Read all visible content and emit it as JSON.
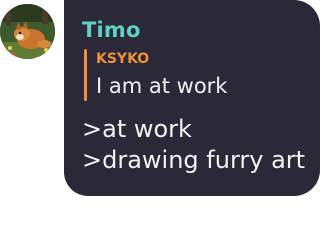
{
  "message": {
    "sender": "Timo",
    "sender_color": "#5ed1c3",
    "avatar_icon": "fox-avatar-icon",
    "reply": {
      "author": "KSYKO",
      "author_color": "#f0913a",
      "text": "I am at work"
    },
    "lines": [
      ">at work",
      ">drawing furry art"
    ],
    "bubble_color": "#2b2838"
  }
}
